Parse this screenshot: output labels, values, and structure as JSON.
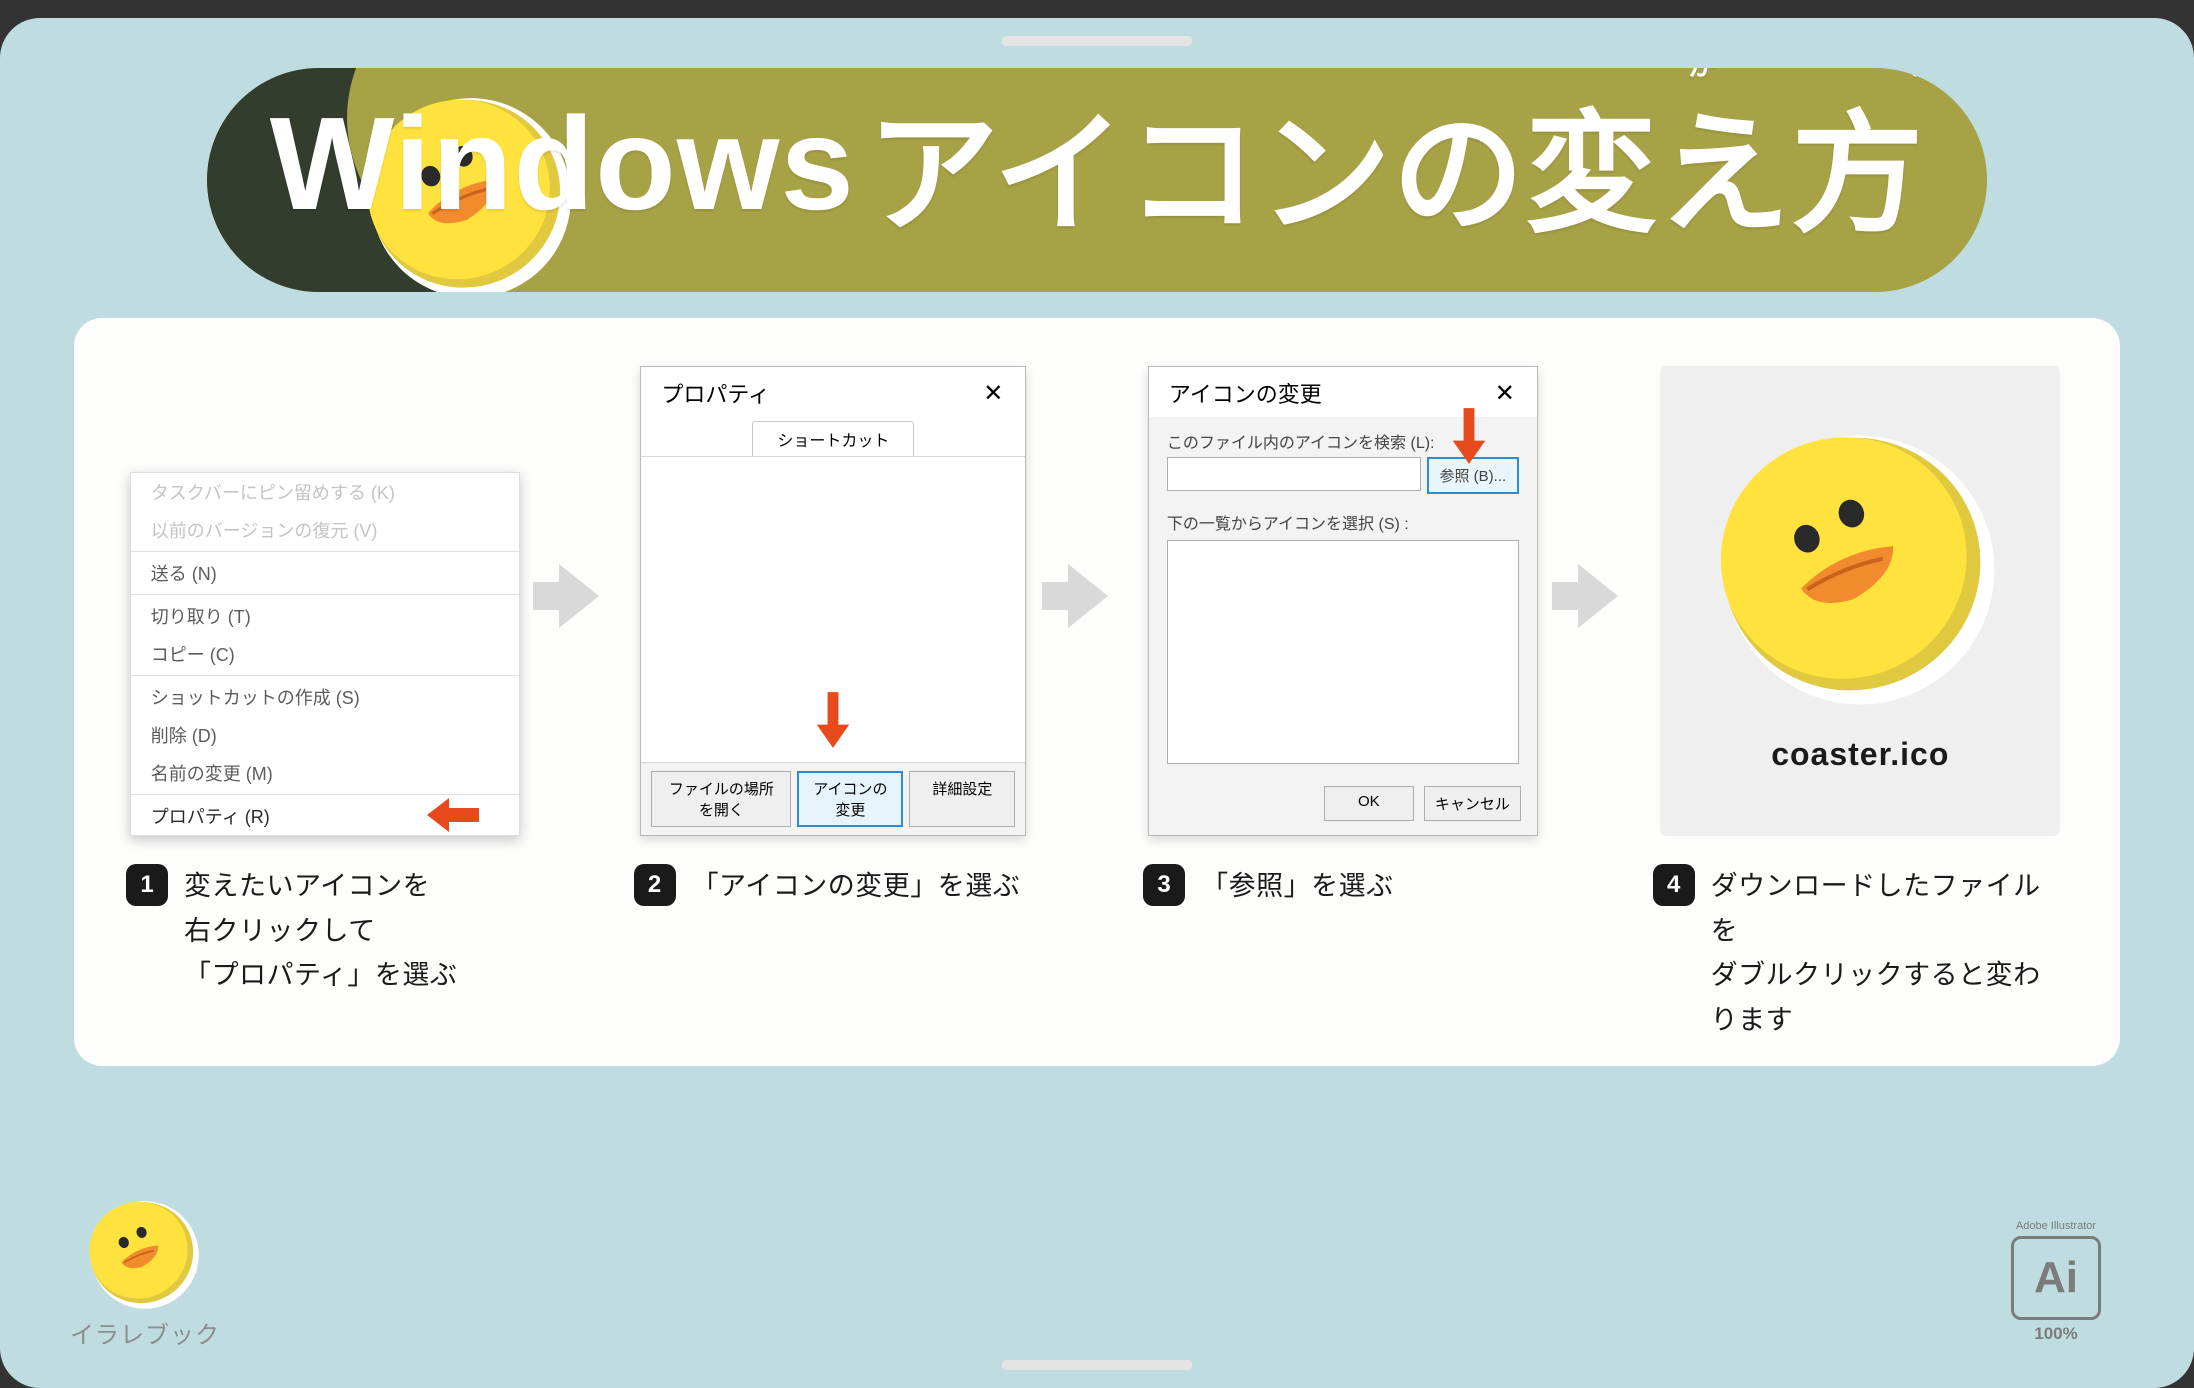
{
  "banner": {
    "title_en": "Windows",
    "title_jp": "アイコンの変え方",
    "ruby1": "か",
    "ruby2": "かた"
  },
  "steps": {
    "s1": {
      "num": "1",
      "caption": "変えたいアイコンを\n右クリックして\n「プロパティ」を選ぶ",
      "menu": {
        "faded1": "タスクバーにピン留めする (K)",
        "faded2": "以前のバージョンの復元 (V)",
        "send": "送る (N)",
        "cut": "切り取り (T)",
        "copy": "コピー (C)",
        "shortcut": "ショットカットの作成 (S)",
        "delete": "削除 (D)",
        "rename": "名前の変更 (M)",
        "properties": "プロパティ (R)"
      }
    },
    "s2": {
      "num": "2",
      "caption": "「アイコンの変更」を選ぶ",
      "dialog": {
        "title": "プロパティ",
        "tab": "ショートカット",
        "btn_open": "ファイルの場所を開く",
        "btn_change": "アイコンの変更",
        "btn_detail": "詳細設定"
      }
    },
    "s3": {
      "num": "3",
      "caption": "「参照」を選ぶ",
      "dialog": {
        "title": "アイコンの変更",
        "lbl_search": "このファイル内のアイコンを検索 (L):",
        "btn_browse": "参照 (B)...",
        "lbl_select": "下の一覧からアイコンを選択 (S) :",
        "btn_ok": "OK",
        "btn_cancel": "キャンセル"
      }
    },
    "s4": {
      "num": "4",
      "caption": "ダウンロードしたファイルを\nダブルクリックすると変わります",
      "filename": "coaster.ico"
    }
  },
  "footer": {
    "brand": "イラレブック",
    "ai_label": "Adobe Illustrator",
    "ai_mark": "Ai",
    "ai_pct": "100%"
  },
  "colors": {
    "accent_olive": "#a7a246",
    "accent_orange": "#e74a1c",
    "accent_blue": "#2a8dd4"
  }
}
